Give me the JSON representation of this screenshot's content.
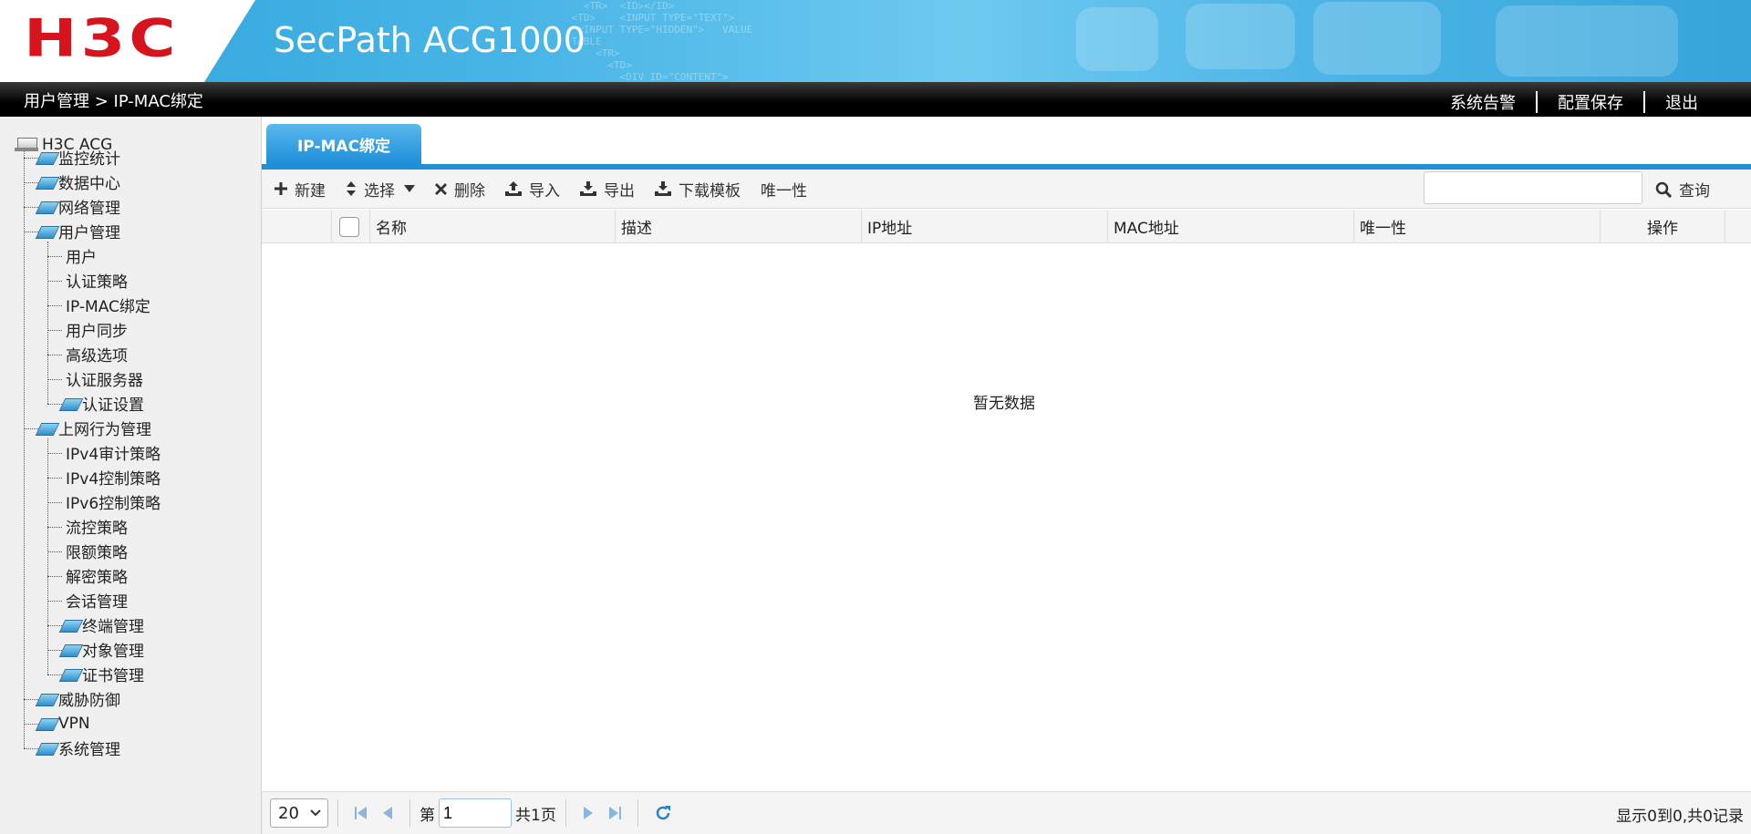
{
  "header": {
    "logo": "H3C",
    "product": "SecPath ACG1000"
  },
  "nav": {
    "breadcrumb": "用户管理 > IP-MAC绑定",
    "links": [
      "系统告警",
      "配置保存",
      "退出"
    ]
  },
  "sidebar": {
    "root": "H3C ACG",
    "items": [
      {
        "label": "监控统计",
        "level": 1,
        "folder": true
      },
      {
        "label": "数据中心",
        "level": 1,
        "folder": true
      },
      {
        "label": "网络管理",
        "level": 1,
        "folder": true
      },
      {
        "label": "用户管理",
        "level": 1,
        "folder": true
      },
      {
        "label": "用户",
        "level": 2,
        "folder": false
      },
      {
        "label": "认证策略",
        "level": 2,
        "folder": false
      },
      {
        "label": "IP-MAC绑定",
        "level": 2,
        "folder": false
      },
      {
        "label": "用户同步",
        "level": 2,
        "folder": false
      },
      {
        "label": "高级选项",
        "level": 2,
        "folder": false
      },
      {
        "label": "认证服务器",
        "level": 2,
        "folder": false
      },
      {
        "label": "认证设置",
        "level": 2,
        "folder": true
      },
      {
        "label": "上网行为管理",
        "level": 1,
        "folder": true
      },
      {
        "label": "IPv4审计策略",
        "level": 2,
        "folder": false
      },
      {
        "label": "IPv4控制策略",
        "level": 2,
        "folder": false
      },
      {
        "label": "IPv6控制策略",
        "level": 2,
        "folder": false
      },
      {
        "label": "流控策略",
        "level": 2,
        "folder": false
      },
      {
        "label": "限额策略",
        "level": 2,
        "folder": false
      },
      {
        "label": "解密策略",
        "level": 2,
        "folder": false
      },
      {
        "label": "会话管理",
        "level": 2,
        "folder": false
      },
      {
        "label": "终端管理",
        "level": 2,
        "folder": true
      },
      {
        "label": "对象管理",
        "level": 2,
        "folder": true
      },
      {
        "label": "证书管理",
        "level": 2,
        "folder": true
      },
      {
        "label": "威胁防御",
        "level": 1,
        "folder": true
      },
      {
        "label": "VPN",
        "level": 1,
        "folder": true
      },
      {
        "label": "系统管理",
        "level": 1,
        "folder": true
      }
    ]
  },
  "tab": {
    "label": "IP-MAC绑定"
  },
  "toolbar": {
    "new": "新建",
    "select": "选择",
    "delete": "删除",
    "import": "导入",
    "export": "导出",
    "download_template": "下载模板",
    "uniqueness": "唯一性",
    "search_placeholder": "",
    "search": "查询"
  },
  "grid": {
    "columns": [
      "名称",
      "描述",
      "IP地址",
      "MAC地址",
      "唯一性",
      "操作"
    ],
    "empty_text": "暂无数据"
  },
  "pager": {
    "page_size": "20",
    "page_prefix": "第",
    "page_value": "1",
    "page_total": "共1页",
    "record_info": "显示0到0,共0记录"
  },
  "colors": {
    "accent": "#1f8fd8",
    "logo_red": "#d7141d"
  }
}
